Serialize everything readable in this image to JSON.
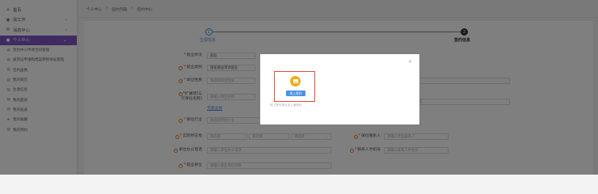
{
  "sidebar": {
    "items": [
      {
        "label": "首页",
        "icon": "home-icon",
        "glyph": "⌂"
      },
      {
        "label": "找工作",
        "icon": "eye-icon",
        "glyph": "◉"
      },
      {
        "label": "消息中心",
        "icon": "chat-icon",
        "glyph": "✉"
      },
      {
        "label": "个人中心",
        "icon": "user-icon",
        "glyph": "●"
      }
    ],
    "subitems": [
      {
        "label": "签约中心申请合同管理",
        "glyph": "▤"
      },
      {
        "label": "报到证申请和档案转移地址管理",
        "glyph": "▤"
      },
      {
        "label": "签约画像",
        "glyph": "▤"
      },
      {
        "label": "我的简历",
        "glyph": "▤"
      },
      {
        "label": "生源信息",
        "glyph": "▤"
      },
      {
        "label": "我的面试",
        "glyph": "▤"
      },
      {
        "label": "我的投递",
        "glyph": "▤"
      },
      {
        "label": "我的收藏",
        "glyph": "★"
      },
      {
        "label": "我的预约",
        "glyph": "▤"
      }
    ]
  },
  "breadcrumb": {
    "items": [
      "个人中心",
      "签约列表",
      "签约中心"
    ],
    "separator": ">"
  },
  "steps": {
    "step1": {
      "num": "1",
      "label": "生源信息"
    },
    "step2": {
      "num": "2",
      "label": "签约信息"
    }
  },
  "form": {
    "employment_status": {
      "label": "就业状况",
      "value": "就业"
    },
    "employment_type": {
      "label": "就业类别",
      "value": "国家基层项目就业"
    },
    "unit_nature": {
      "label": "单位性质",
      "placeholder": "请选择单位性质"
    },
    "credit_code": {
      "label1": "*扩展项(与",
      "label2": "行单位名称)",
      "placeholder": "请输入单位名称",
      "link": "无需查询"
    },
    "unit_industry": {
      "label": "单位行业",
      "placeholder": "请选择单位行业"
    },
    "unit_location": {
      "label": "实际所在地",
      "province": "请选择",
      "city": "请选择",
      "district": "请选择"
    },
    "unit_phone": {
      "label": "单位办公电话",
      "placeholder": "请输入单位办公电话"
    },
    "employment_unit": {
      "label": "就业单位",
      "placeholder": "请输入就业单位名称"
    },
    "right_select_placeholder": "请选择",
    "right_code_placeholder": "请输入统一社会信用代码",
    "contact": {
      "label": "单位联系人",
      "placeholder": "请输入单位联系人"
    },
    "contact_phone": {
      "label": "联系人手机号",
      "placeholder": "请输入联系人手机号"
    }
  },
  "modal": {
    "close": "×",
    "upload_label": "线上签约",
    "hint": "线上签约请点击上面签约"
  },
  "colors": {
    "accent": "#7e57c2",
    "primary": "#4a90e2",
    "upload": "#f0ad17",
    "highlight": "#e74c3c"
  }
}
